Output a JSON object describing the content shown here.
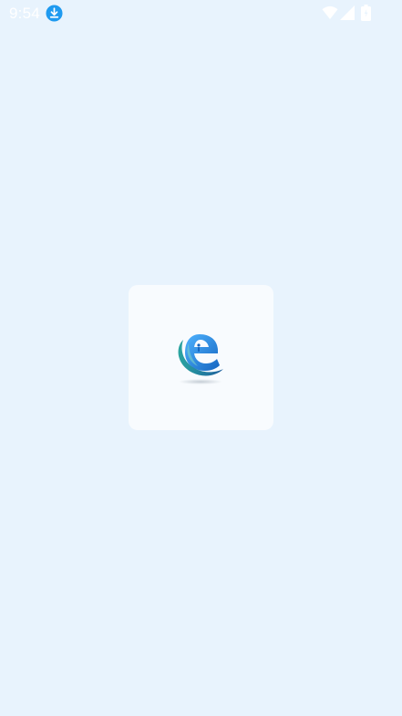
{
  "status_bar": {
    "time": "9:54",
    "notification_icon": "download-icon",
    "icons": [
      "wifi-icon",
      "signal-icon",
      "battery-icon"
    ]
  },
  "splash": {
    "logo_icon": "app-logo-icon"
  },
  "colors": {
    "background": "#e8f3fd",
    "card": "#f8fbfe",
    "accent_blue": "#1e88e5",
    "teal": "#3a9aa6"
  }
}
